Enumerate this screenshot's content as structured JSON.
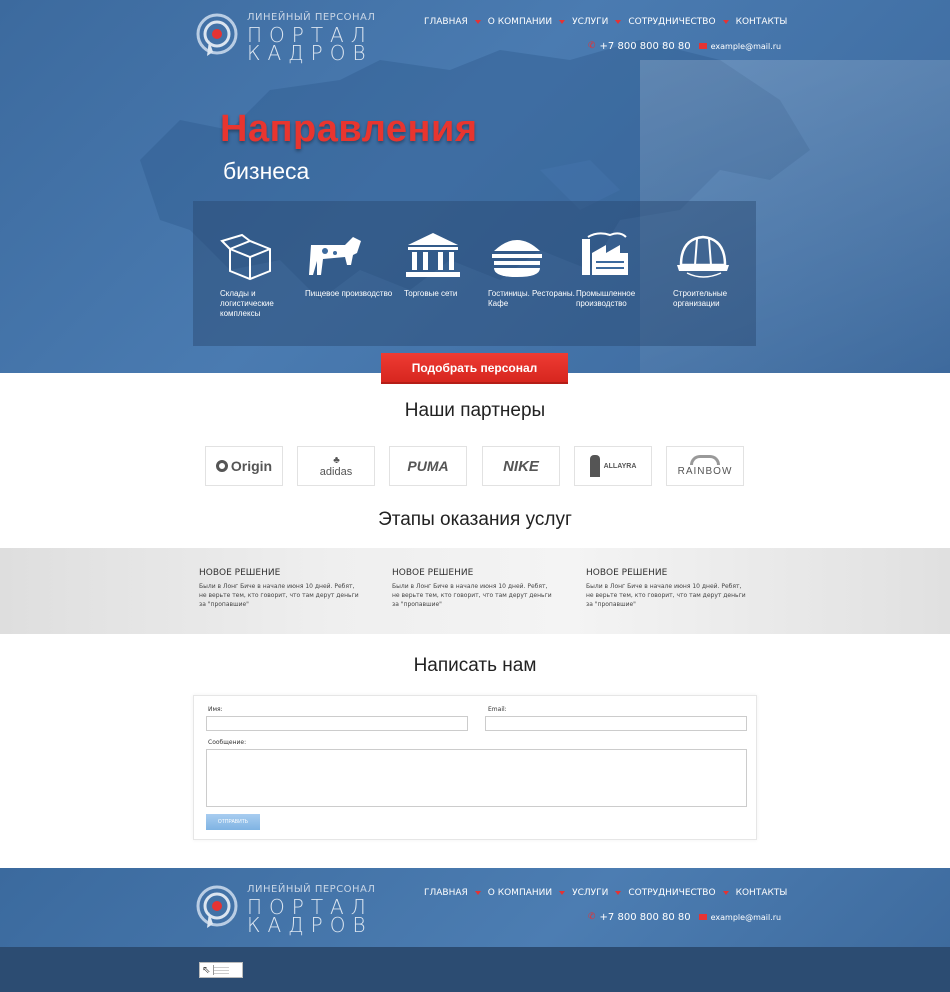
{
  "logo": {
    "small": "ЛИНЕЙНЫЙ ПЕРСОНАЛ",
    "line1": "ПОРТАЛ",
    "line2": "КАДРОВ"
  },
  "nav": [
    "ГЛАВНАЯ",
    "О КОМПАНИИ",
    "УСЛУГИ",
    "СОТРУДНИЧЕСТВО",
    "КОНТАКТЫ"
  ],
  "contacts": {
    "phone": "+7 800 800 80 80",
    "email": "example@mail.ru"
  },
  "hero": {
    "title": "Направления",
    "subtitle": "бизнеса"
  },
  "directions": [
    {
      "icon": "box-icon",
      "label": "Склады и логистические комплексы"
    },
    {
      "icon": "cow-icon",
      "label": "Пищевое производство"
    },
    {
      "icon": "bank-icon",
      "label": "Торговые сети"
    },
    {
      "icon": "burger-icon",
      "label": "Гостиницы. Рестораны. Кафе"
    },
    {
      "icon": "factory-icon",
      "label": "Промышленное производство"
    },
    {
      "icon": "helmet-icon",
      "label": "Строительные организации"
    }
  ],
  "cta": "Подобрать персонал",
  "partners": {
    "title": "Наши партнеры",
    "logos": [
      "Origin",
      "adidas",
      "PUMA",
      "NIKE",
      "ALLAYRA",
      "RAINBOW"
    ]
  },
  "stages": {
    "title": "Этапы оказания услуг",
    "items": [
      {
        "heading": "НОВОЕ РЕШЕНИЕ",
        "text": "Были в Лонг Биче в начале июня 10 дней. Ребят, не верьте тем, кто говорит, что там дерут деньги за \"пропавшие\""
      },
      {
        "heading": "НОВОЕ РЕШЕНИЕ",
        "text": "Были в Лонг Биче в начале июня 10 дней. Ребят, не верьте тем, кто говорит, что там дерут деньги за \"пропавшие\""
      },
      {
        "heading": "НОВОЕ РЕШЕНИЕ",
        "text": "Были в Лонг Биче в начале июня 10 дней. Ребят, не верьте тем, кто говорит, что там дерут деньги за \"пропавшие\""
      }
    ]
  },
  "form": {
    "title": "Написать нам",
    "name_label": "Имя:",
    "email_label": "Email:",
    "message_label": "Сообщение:",
    "submit": "ОТПРАВИТЬ",
    "name_value": "",
    "email_value": "",
    "message_value": ""
  },
  "colors": {
    "accent": "#e8352f",
    "primary": "#3c6a9e",
    "footer_bottom": "#2c4c72",
    "button": "#8fbfe9"
  }
}
